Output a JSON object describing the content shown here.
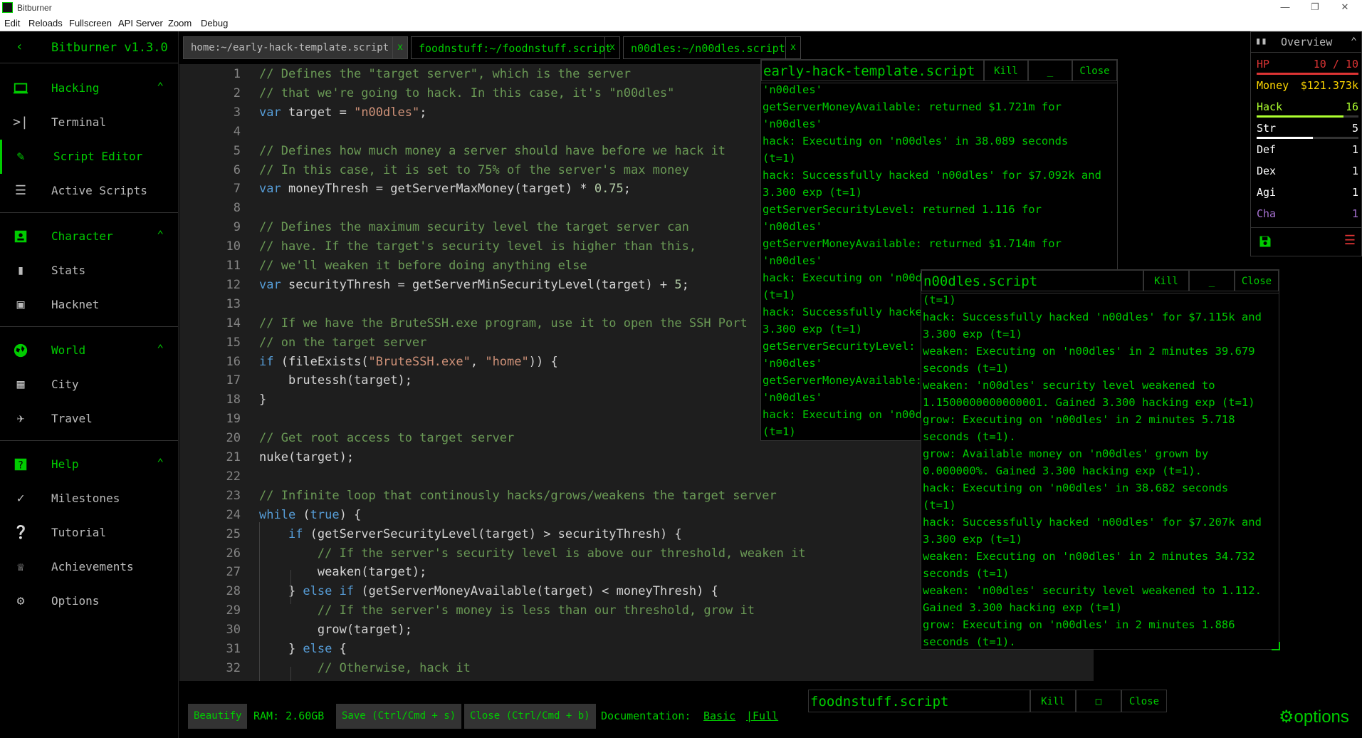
{
  "window": {
    "title": "Bitburner"
  },
  "menu": [
    "Edit",
    "Reloads",
    "Fullscreen",
    "API Server",
    "Zoom",
    "Debug"
  ],
  "sidebar": {
    "version": "Bitburner v1.3.0",
    "sections": [
      {
        "label": "Hacking",
        "items": [
          "Terminal",
          "Script Editor",
          "Active Scripts"
        ]
      },
      {
        "label": "Character",
        "items": [
          "Stats",
          "Hacknet"
        ]
      },
      {
        "label": "World",
        "items": [
          "City",
          "Travel"
        ]
      },
      {
        "label": "Help",
        "items": [
          "Milestones",
          "Tutorial",
          "Achievements",
          "Options"
        ]
      }
    ]
  },
  "tabs": [
    {
      "label": "home:~/early-hack-template.script",
      "close": "x"
    },
    {
      "label": "foodnstuff:~/foodnstuff.script",
      "close": "x"
    },
    {
      "label": "n00dles:~/n00dles.script",
      "close": "x"
    }
  ],
  "editor": {
    "lines": [
      "// Defines the \"target server\", which is the server",
      "// that we're going to hack. In this case, it's \"n00dles\"",
      "var target = \"n00dles\";",
      "",
      "// Defines how much money a server should have before we hack it",
      "// In this case, it is set to 75% of the server's max money",
      "var moneyThresh = getServerMaxMoney(target) * 0.75;",
      "",
      "// Defines the maximum security level the target server can",
      "// have. If the target's security level is higher than this,",
      "// we'll weaken it before doing anything else",
      "var securityThresh = getServerMinSecurityLevel(target) + 5;",
      "",
      "// If we have the BruteSSH.exe program, use it to open the SSH Port",
      "// on the target server",
      "if (fileExists(\"BruteSSH.exe\", \"home\")) {",
      "    brutessh(target);",
      "}",
      "",
      "// Get root access to target server",
      "nuke(target);",
      "",
      "// Infinite loop that continously hacks/grows/weakens the target server",
      "while (true) {",
      "    if (getServerSecurityLevel(target) > securityThresh) {",
      "        // If the server's security level is above our threshold, weaken it",
      "        weaken(target);",
      "    } else if (getServerMoneyAvailable(target) < moneyThresh) {",
      "        // If the server's money is less than our threshold, grow it",
      "        grow(target);",
      "    } else {",
      "        // Otherwise, hack it"
    ]
  },
  "toolbar": {
    "beautify": "Beautify",
    "ram": "RAM: 2.60GB",
    "save": "Save (Ctrl/Cmd + s)",
    "close": "Close (Ctrl/Cmd + b)",
    "doc_label": "Documentation:",
    "doc_basic": "Basic",
    "doc_full": "|Full"
  },
  "log_windows": [
    {
      "title": "early-hack-template.script",
      "kill": "Kill",
      "minimize": "_",
      "close": "Close",
      "lines": [
        "'n00dles'",
        "getServerMoneyAvailable: returned $1.721m for",
        "'n00dles'",
        "hack: Executing on 'n00dles' in 38.089 seconds",
        "(t=1)",
        "hack: Successfully hacked 'n00dles' for $7.092k and",
        "3.300 exp (t=1)",
        "getServerSecurityLevel: returned 1.116 for",
        "'n00dles'",
        "getServerMoneyAvailable: returned $1.714m for",
        "'n00dles'",
        "hack: Executing on 'n00dles' in 38.682 seconds",
        "(t=1)",
        "hack: Successfully hacked 'n00dles' for $7.207k and",
        "3.300 exp (t=1)",
        "getServerSecurityLevel: returned 1.112 for",
        "'n00dles'",
        "getServerMoneyAvailable: returned $1.707m for",
        "'n00dles'",
        "hack: Executing on 'n00dles' in 38.613 seconds",
        "(t=1)"
      ]
    },
    {
      "title": "n00dles.script",
      "kill": "Kill",
      "minimize": "_",
      "close": "Close",
      "lines": [
        "(t=1)",
        "hack: Successfully hacked 'n00dles' for $7.115k and",
        "3.300 exp (t=1)",
        "weaken: Executing on 'n00dles' in 2 minutes 39.679",
        "seconds (t=1)",
        "weaken: 'n00dles' security level weakened to",
        "1.1500000000000001. Gained 3.300 hacking exp (t=1)",
        "grow: Executing on 'n00dles' in 2 minutes 5.718",
        "seconds (t=1).",
        "grow: Available money on 'n00dles' grown by",
        "0.000000%. Gained 3.300 hacking exp (t=1).",
        "hack: Executing on 'n00dles' in 38.682 seconds",
        "(t=1)",
        "hack: Successfully hacked 'n00dles' for $7.207k and",
        "3.300 exp (t=1)",
        "weaken: Executing on 'n00dles' in 2 minutes 34.732",
        "seconds (t=1)",
        "weaken: 'n00dles' security level weakened to 1.112.",
        "Gained 3.300 hacking exp (t=1)",
        "grow: Executing on 'n00dles' in 2 minutes 1.886",
        "seconds (t=1)."
      ]
    },
    {
      "title": "foodnstuff.script",
      "kill": "Kill",
      "minimize": "□",
      "close": "Close"
    }
  ],
  "overview": {
    "title": "Overview",
    "stats": [
      {
        "key": "HP",
        "value": "10 / 10",
        "color": "#dd3434",
        "level": 1.0
      },
      {
        "key": "Money",
        "value": "$121.373k",
        "color": "#ffd700"
      },
      {
        "key": "Hack",
        "value": "16",
        "color": "#adff2f",
        "level": 0.85
      },
      {
        "key": "Str",
        "value": "5",
        "color": "#ffffff",
        "level": 0.55
      },
      {
        "key": "Def",
        "value": "1",
        "color": "#ffffff"
      },
      {
        "key": "Dex",
        "value": "1",
        "color": "#ffffff"
      },
      {
        "key": "Agi",
        "value": "1",
        "color": "#ffffff"
      },
      {
        "key": "Cha",
        "value": "1",
        "color": "#a671d1"
      }
    ]
  },
  "options_button": "options",
  "colors": {
    "accent": "#00cc00",
    "editor_bg": "#1e1e1e",
    "hp": "#dd3434",
    "money": "#ffd700"
  }
}
